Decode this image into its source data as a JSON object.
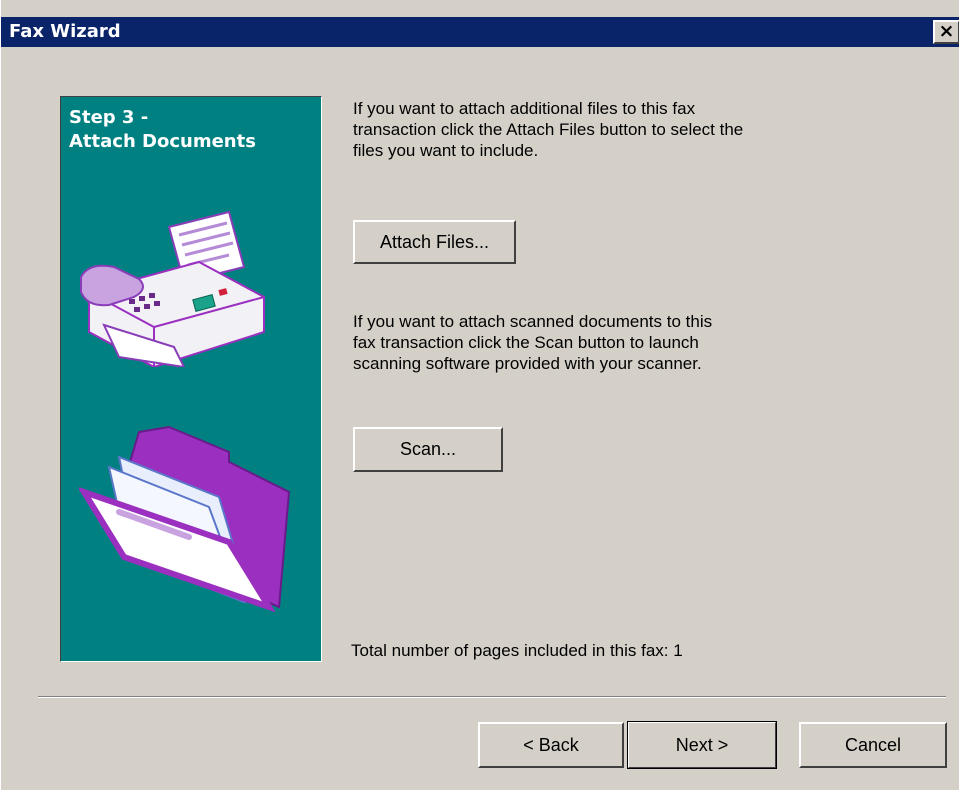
{
  "window": {
    "title": "Fax Wizard",
    "close_glyph": "✕"
  },
  "side_panel": {
    "step_title_line1": "Step 3 -",
    "step_title_line2": "Attach Documents",
    "bg_color": "#008080",
    "images": [
      "fax-machine-icon",
      "folder-icon"
    ]
  },
  "content": {
    "attach_paragraph": "If you want to attach additional files to this fax\ntransaction click the Attach Files button to select the\nfiles you want to include.",
    "attach_button": "Attach Files...",
    "scan_paragraph": "If you want to attach scanned documents to this\nfax transaction click the Scan button to launch\nscanning software provided with your scanner.",
    "scan_button": "Scan...",
    "pages_label": "Total number of pages included in this fax:",
    "pages_count": "1"
  },
  "footer": {
    "back_button": "< Back",
    "next_button": "Next >",
    "cancel_button": "Cancel"
  },
  "colors": {
    "titlebar": "#0a246a",
    "dialog_bg": "#d4d0c8",
    "panel_teal": "#008080",
    "purple_accent": "#9b30c0"
  }
}
